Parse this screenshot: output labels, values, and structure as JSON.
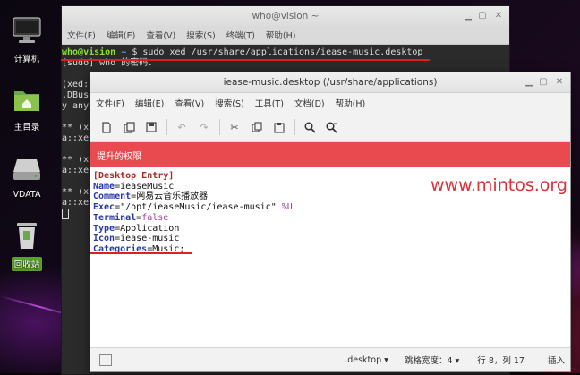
{
  "desktop": {
    "icons": [
      {
        "label": "计算机",
        "icon": "computer-icon"
      },
      {
        "label": "主目录",
        "icon": "home-folder-icon"
      },
      {
        "label": "VDATA",
        "icon": "drive-icon"
      },
      {
        "label": "回收站",
        "icon": "trash-icon"
      }
    ]
  },
  "terminal": {
    "title": "who@vision ~",
    "menu": [
      "文件(F)",
      "编辑(E)",
      "查看(V)",
      "搜索(S)",
      "终端(T)",
      "帮助(H)"
    ],
    "prompt_user": "who@vision",
    "prompt_path": "~",
    "prompt_symbol": "$",
    "command": "sudo xed /usr/share/applications/iease-music.desktop",
    "lines": [
      "[sudo] who 的密码：",
      "",
      "(xed:",
      ".DBus",
      "y any",
      "",
      "** (x",
      "a::xe",
      "",
      "** (x",
      "a::xe",
      "",
      "** (x",
      "a::xe"
    ]
  },
  "editor": {
    "title": "iease-music.desktop (/usr/share/applications)",
    "menu": [
      "文件(F)",
      "编辑(E)",
      "查看(V)",
      "搜索(S)",
      "工具(T)",
      "文档(D)",
      "帮助(H)"
    ],
    "banner": "提升的权限",
    "content": {
      "section": "[Desktop Entry]",
      "name_key": "Name",
      "name_val": "ieaseMusic",
      "comment_key": "Comment",
      "comment_val": "网易云音乐播放器",
      "exec_key": "Exec",
      "exec_val": "\"/opt/ieaseMusic/iease-music\"",
      "exec_arg": "%U",
      "terminal_key": "Terminal",
      "terminal_val": "false",
      "type_key": "Type",
      "type_val": "Application",
      "icon_key": "Icon",
      "icon_val": "iease-music",
      "categories_key": "Categories",
      "categories_val": "Music;"
    },
    "status": {
      "filetype": ".desktop",
      "tab_width": "跳格宽度：4",
      "position": "行 8，列 17",
      "mode": "插入"
    }
  },
  "watermark": "www.mintos.org"
}
